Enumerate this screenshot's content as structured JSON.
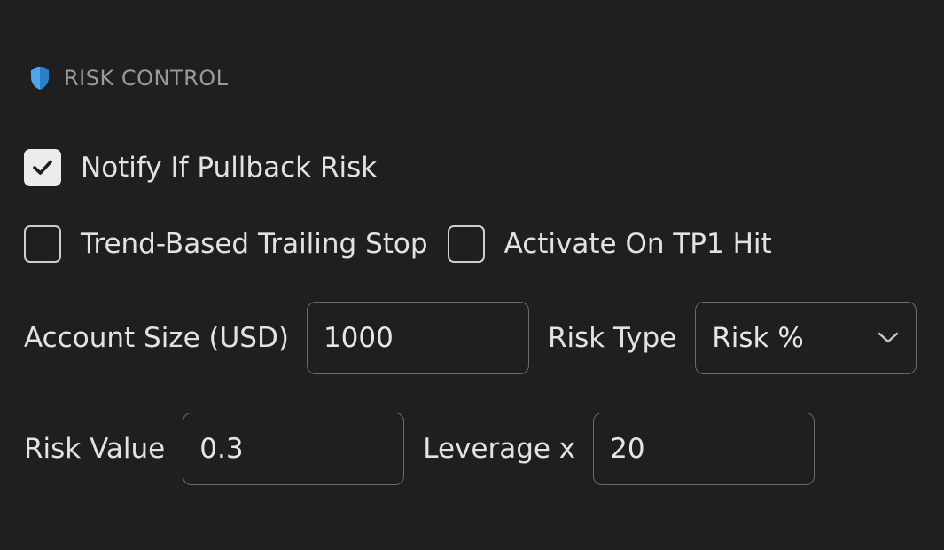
{
  "section": {
    "title": "RISK CONTROL",
    "icon": "shield-icon",
    "accent": "#4aa8f0"
  },
  "options": {
    "notify_pullback": {
      "label": "Notify If Pullback Risk",
      "checked": true
    },
    "trend_trailing_stop": {
      "label": "Trend-Based Trailing Stop",
      "checked": false
    },
    "activate_tp1": {
      "label": "Activate On TP1 Hit",
      "checked": false
    }
  },
  "fields": {
    "account_size": {
      "label": "Account Size (USD)",
      "value": "1000"
    },
    "risk_type": {
      "label": "Risk Type",
      "value": "Risk %"
    },
    "risk_value": {
      "label": "Risk Value",
      "value": "0.3"
    },
    "leverage": {
      "label": "Leverage x",
      "value": "20"
    }
  }
}
